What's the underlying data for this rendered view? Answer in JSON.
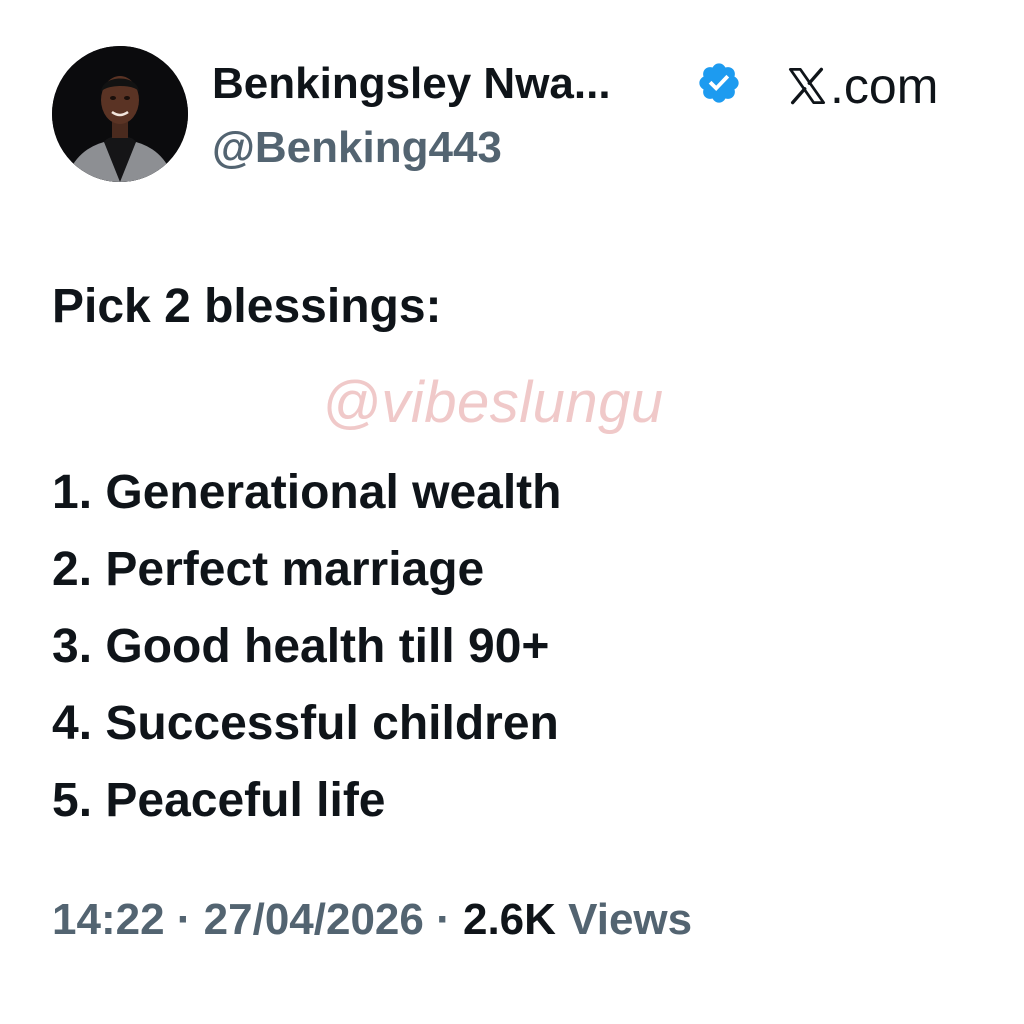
{
  "author": {
    "display_name": "Benkingsley Nwa...",
    "handle": "@Benking443",
    "verified": true,
    "avatar_icon": "profile-photo"
  },
  "source": {
    "site": ".com",
    "logo_icon": "x-logo-icon"
  },
  "tweet": {
    "heading": "Pick 2 blessings:",
    "items": [
      "1. Generational wealth",
      "2. Perfect marriage",
      "3. Good health till 90+",
      "4. Successful children",
      "5. Peaceful life"
    ]
  },
  "watermark": "@vibeslungu",
  "meta": {
    "time": "14:22",
    "separator": " · ",
    "date": "27/04/2026",
    "views_count": "2.6K",
    "views_label": " Views"
  },
  "colors": {
    "text": "#0f1419",
    "secondary": "#536471",
    "verified_badge": "#1d9bf0",
    "watermark": "#f0c9c9"
  }
}
